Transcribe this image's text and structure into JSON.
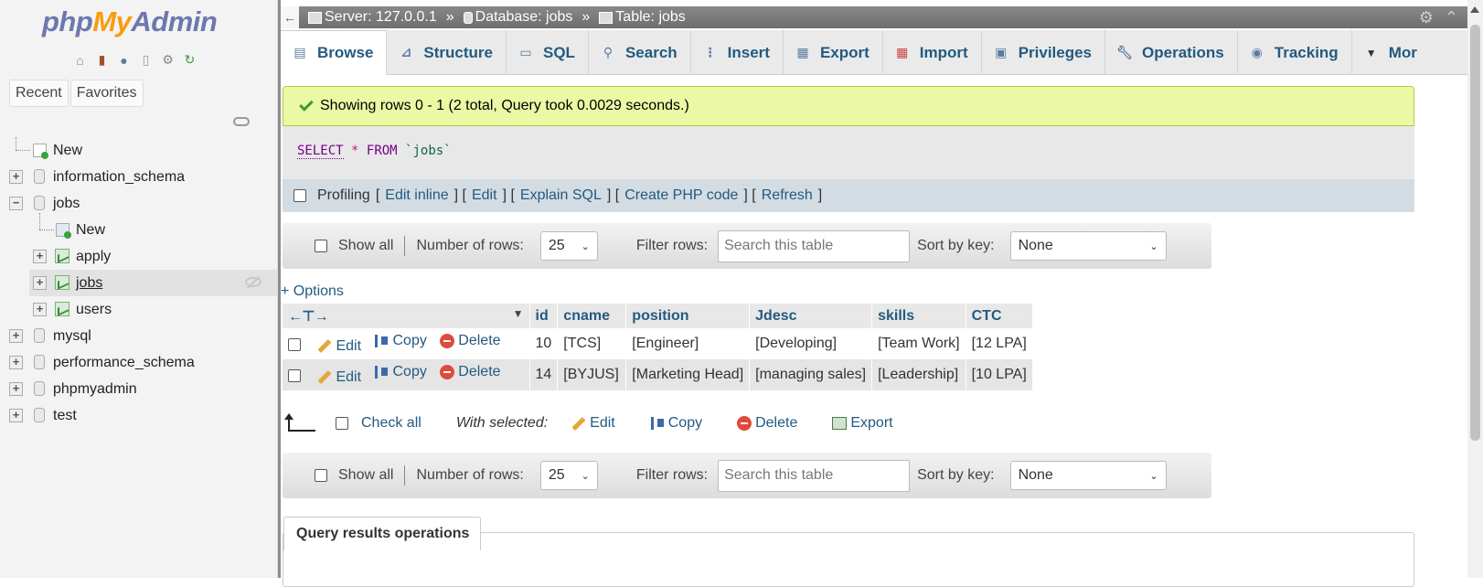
{
  "logo": {
    "php": "php",
    "my": "My",
    "admin": "Admin"
  },
  "nav": {
    "tabs": [
      "Recent",
      "Favorites"
    ],
    "tree": {
      "new": "New",
      "information_schema": "information_schema",
      "jobs": "jobs",
      "jobs_new": "New",
      "apply": "apply",
      "jobs_table": "jobs",
      "users": "users",
      "mysql": "mysql",
      "performance_schema": "performance_schema",
      "phpmyadmin": "phpmyadmin",
      "test": "test"
    }
  },
  "breadcrumb": {
    "server": "Server: 127.0.0.1",
    "database": "Database: jobs",
    "table": "Table: jobs",
    "sep": "»"
  },
  "menu": [
    "Browse",
    "Structure",
    "SQL",
    "Search",
    "Insert",
    "Export",
    "Import",
    "Privileges",
    "Operations",
    "Tracking",
    "Mor"
  ],
  "success_message": "Showing rows 0 - 1 (2 total, Query took 0.0029 seconds.)",
  "sql": {
    "select": "SELECT",
    "star": "*",
    "from": "FROM",
    "table": "`jobs`"
  },
  "profiling": {
    "label": "Profiling",
    "edit_inline": "Edit inline",
    "edit": "Edit",
    "explain": "Explain SQL",
    "php": "Create PHP code",
    "refresh": "Refresh"
  },
  "navbox": {
    "show_all": "Show all",
    "num_rows_label": "Number of rows:",
    "num_rows": "25",
    "filter_label": "Filter rows:",
    "filter_placeholder": "Search this table",
    "sort_label": "Sort by key:",
    "sort_value": "None"
  },
  "options_link": "+ Options",
  "table": {
    "columns": [
      "id",
      "cname",
      "position",
      "Jdesc",
      "skills",
      "CTC"
    ],
    "actions": {
      "edit": "Edit",
      "copy": "Copy",
      "delete": "Delete"
    },
    "rows": [
      {
        "id": "10",
        "cname": "[TCS]",
        "position": "[Engineer]",
        "jdesc": "[Developing]",
        "skills": "[Team Work]",
        "ctc": "[12 LPA]"
      },
      {
        "id": "14",
        "cname": "[BYJUS]",
        "position": "[Marketing Head]",
        "jdesc": "[managing sales]",
        "skills": "[Leadership]",
        "ctc": "[10 LPA]"
      }
    ]
  },
  "with_selected": {
    "check_all": "Check all",
    "label": "With selected:",
    "edit": "Edit",
    "copy": "Copy",
    "delete": "Delete",
    "export": "Export"
  },
  "query_results_ops": "Query results operations"
}
